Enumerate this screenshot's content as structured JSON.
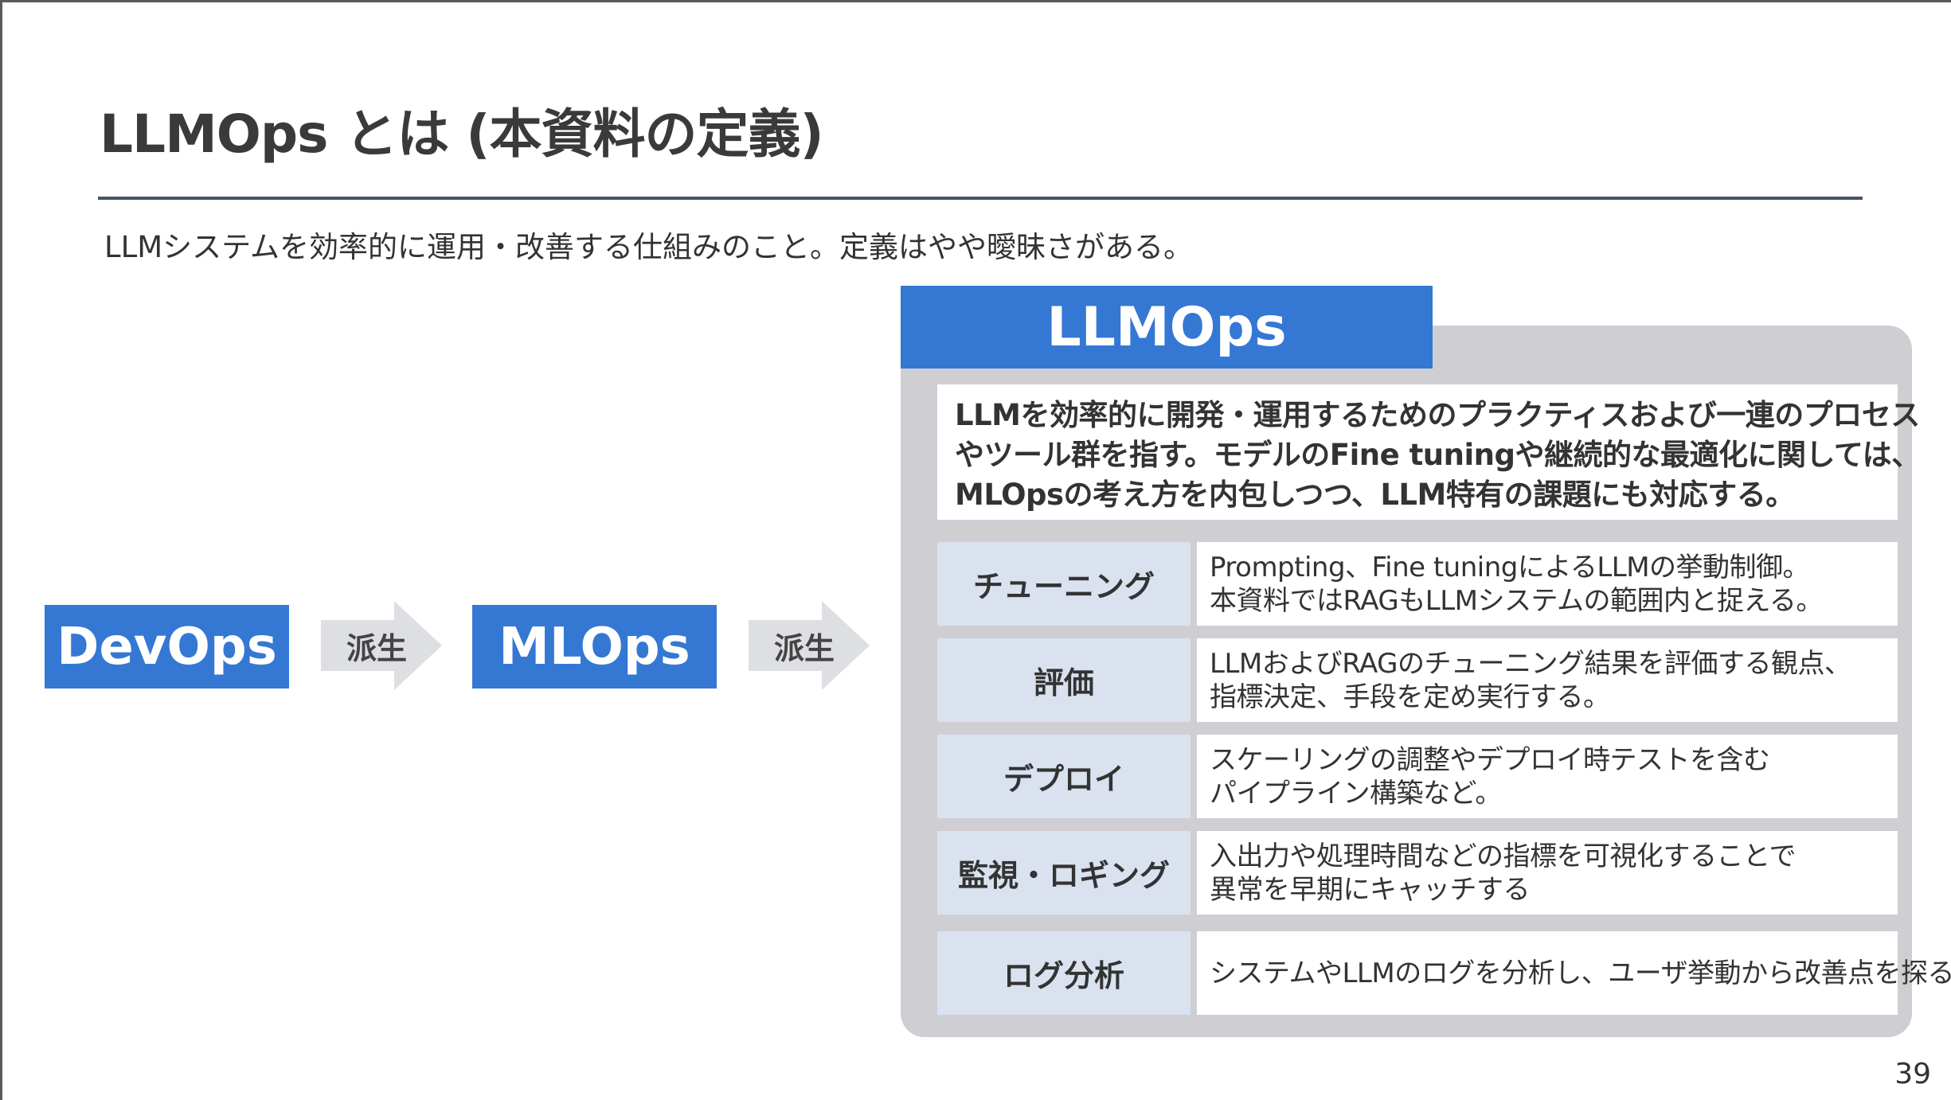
{
  "slide": {
    "title": "LLMOps とは (本資料の定義)",
    "subtitle": "LLMシステムを効率的に運用・改善する仕組みのこと。定義はやや曖昧さがある。",
    "page_number": "39"
  },
  "flow": {
    "devops": "DevOps",
    "arrow1_label": "派生",
    "mlops": "MLOps",
    "arrow2_label": "派生"
  },
  "llmops": {
    "heading": "LLMOps",
    "description": [
      "LLMを効率的に開発・運用するためのプラクティスおよび一連のプロセス",
      "やツール群を指す。モデルのFine tuningや継続的な最適化に関しては、",
      "MLOpsの考え方を内包しつつ、LLM特有の課題にも対応する。"
    ],
    "rows": [
      {
        "label": "チューニング",
        "lines": [
          "Prompting、Fine tuningによるLLMの挙動制御。",
          "本資料ではRAGもLLMシステムの範囲内と捉える。"
        ]
      },
      {
        "label": "評価",
        "lines": [
          "LLMおよびRAGのチューニング結果を評価する観点、",
          "指標決定、手段を定め実行する。"
        ]
      },
      {
        "label": "デプロイ",
        "lines": [
          "スケーリングの調整やデプロイ時テストを含む",
          "パイプライン構築など。"
        ]
      },
      {
        "label": "監視・ロギング",
        "lines": [
          "入出力や処理時間などの指標を可視化することで",
          "異常を早期にキャッチする"
        ]
      },
      {
        "label": "ログ分析",
        "lines": [
          "システムやLLMのログを分析し、ユーザ挙動から改善点を探る"
        ]
      }
    ]
  },
  "colors": {
    "accent_blue": "#3478d4",
    "panel_gray": "#cfcfd3",
    "label_cell": "#dae2f0",
    "arrow_gray": "#dedfe3",
    "rule": "#44546a"
  }
}
